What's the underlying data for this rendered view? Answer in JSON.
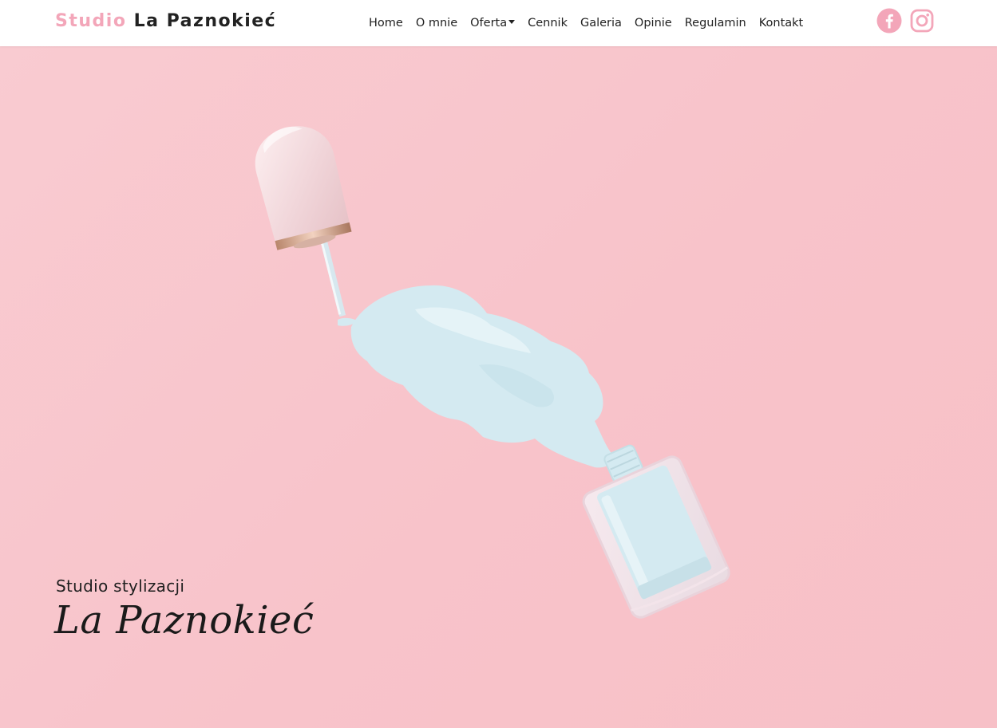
{
  "brand": {
    "accent": "Studio",
    "name": "La Paznokieć",
    "accent_color": "#f3a6b9"
  },
  "nav": {
    "items": [
      {
        "label": "Home"
      },
      {
        "label": "O mnie"
      },
      {
        "label": "Oferta",
        "has_dropdown": true
      },
      {
        "label": "Cennik"
      },
      {
        "label": "Galeria"
      },
      {
        "label": "Opinie"
      },
      {
        "label": "Regulamin"
      },
      {
        "label": "Kontakt"
      }
    ]
  },
  "socials": [
    {
      "icon": "facebook-icon",
      "color": "#f3a6b9"
    },
    {
      "icon": "instagram-icon",
      "color": "#f3a6b9"
    }
  ],
  "hero": {
    "image": "pink-background-nail-polish-spill",
    "subtitle": "Studio stylizacji",
    "title": "La Paznokieć",
    "background_color": "#f8c6cc",
    "polish_color": "#d4eaf1"
  }
}
